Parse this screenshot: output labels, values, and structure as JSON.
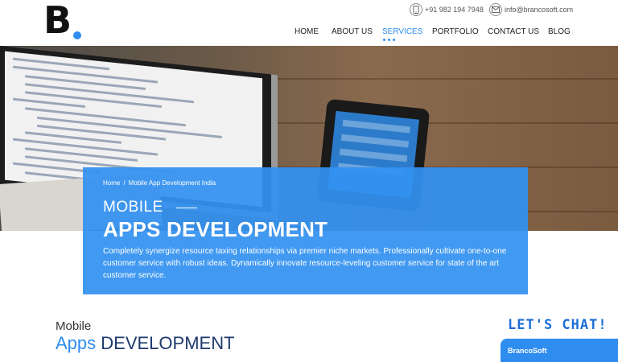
{
  "header": {
    "logo_letter": "B.",
    "phone": "+91 982 194 7948",
    "email": "info@brancosoft.com"
  },
  "nav": {
    "items": [
      "HOME",
      "ABOUT US",
      "SERVICES",
      "PORTFOLIO",
      "CONTACT US",
      "BLOG"
    ],
    "active": "SERVICES"
  },
  "hero": {
    "breadcrumb": [
      "Home",
      "/",
      "Mobile App Development India"
    ],
    "subtitle": "MOBILE",
    "title": "APPS DEVELOPMENT",
    "description": "Completely synergize resource taxing relationships via premier niche markets. Professionally cultivate one-to-one customer service with robust ideas. Dynamically innovate resource-leveling customer service for state of the art customer service."
  },
  "section": {
    "subtitle": "Mobile",
    "title_accent": "Apps",
    "title_rest": " DEVELOPMENT"
  },
  "chat": {
    "title": "LET'S CHAT!",
    "name": "BrancoSoft"
  },
  "colors": {
    "accent": "#2f8df0",
    "overlay": "#3391f0",
    "dark_title": "#1e3a6d"
  }
}
